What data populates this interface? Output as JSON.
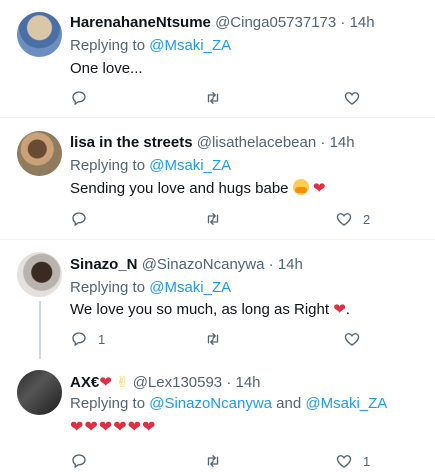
{
  "tweets": [
    {
      "name": "HarenahaneNtsume",
      "handle": "@Cinga05737173",
      "time": "14h",
      "replying_prefix": "Replying to ",
      "mentions": [
        "@Msaki_ZA"
      ],
      "text": "One love...",
      "reply_count": "",
      "retweet_count": "",
      "like_count": ""
    },
    {
      "name": "lisa in the streets",
      "handle": "@lisathelacebean",
      "time": "14h",
      "replying_prefix": "Replying to ",
      "mentions": [
        "@Msaki_ZA"
      ],
      "text": "Sending you love and hugs babe",
      "reply_count": "",
      "retweet_count": "",
      "like_count": "2"
    },
    {
      "name": "Sinazo_N",
      "handle": "@SinazoNcanywa",
      "time": "14h",
      "replying_prefix": "Replying to ",
      "mentions": [
        "@Msaki_ZA"
      ],
      "text": "We love you so much, as long as Right",
      "text_end": ".",
      "reply_count": "1",
      "retweet_count": "",
      "like_count": ""
    },
    {
      "name": "AX€",
      "handle": "@Lex130593",
      "time": "14h",
      "replying_prefix": "Replying to ",
      "mentions": [
        "@SinazoNcanywa",
        "@Msaki_ZA"
      ],
      "mention_joiner": " and ",
      "text": "❤❤❤❤❤❤",
      "reply_count": "",
      "retweet_count": "",
      "like_count": "1"
    }
  ],
  "dot": "·",
  "heart_glyph": "❤",
  "peace_glyph": "✌",
  "colors": {
    "accent": "#1d9bf0",
    "muted": "#536471",
    "heart": "#dd2e44",
    "divider": "#eff3f4"
  },
  "icons": {
    "reply": "reply-icon",
    "retweet": "retweet-icon",
    "like": "like-icon",
    "share": "share-icon"
  }
}
